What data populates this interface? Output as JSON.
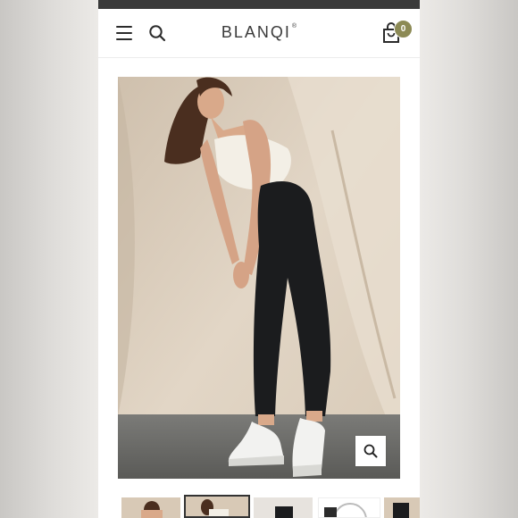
{
  "header": {
    "brand_text": "BLANQI",
    "brand_mark": "®",
    "cart_count": "0",
    "icons": [
      "hamburger-menu-icon",
      "search-icon",
      "shopping-bag-icon",
      "zoom-icon"
    ]
  },
  "colors": {
    "status_bar": "#3a3a3a",
    "badge": "#8c8a55",
    "backdrop": "#d9cbb9"
  },
  "gallery": {
    "thumbnail_count": 5,
    "active_thumbnail": 2
  }
}
